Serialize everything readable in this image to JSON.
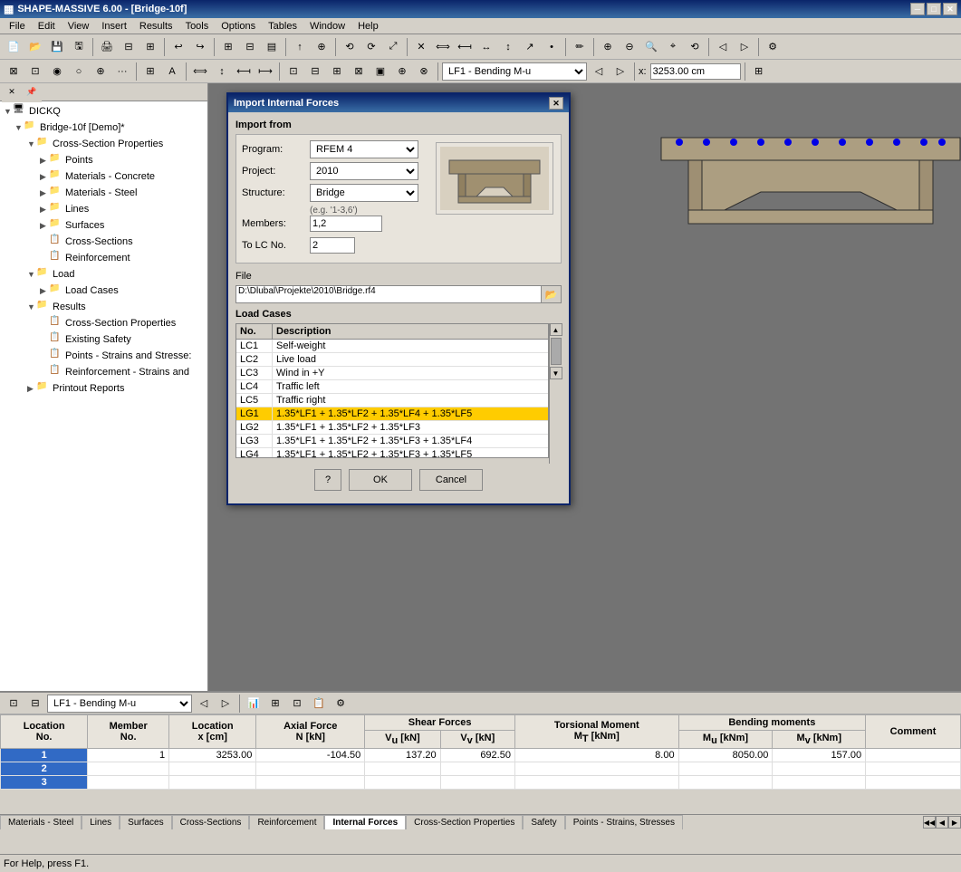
{
  "app": {
    "title": "SHAPE-MASSIVE 6.00 - [Bridge-10f]",
    "icon": "▦"
  },
  "menu": {
    "items": [
      "File",
      "Edit",
      "View",
      "Insert",
      "Results",
      "Tools",
      "Options",
      "Tables",
      "Window",
      "Help"
    ]
  },
  "titlebar": {
    "minimize": "─",
    "maximize": "□",
    "close": "✕",
    "inner_minimize": "─",
    "inner_maximize": "□",
    "inner_close": "✕"
  },
  "toolbar1": {
    "buttons": [
      "📄",
      "💾",
      "🖨",
      "✂",
      "📋",
      "↩",
      "↪",
      "📐",
      "🔍",
      "📊",
      "🔧"
    ]
  },
  "toolbar2": {
    "combo_value": "LF1 - Bending M-u",
    "coord_label": "x:",
    "coord_value": "3253.00 cm"
  },
  "left_panel": {
    "root": "DICKQ",
    "tree_items": [
      {
        "id": "root",
        "label": "DICKQ",
        "indent": 0,
        "expanded": true,
        "type": "root"
      },
      {
        "id": "bridge",
        "label": "Bridge-10f [Demo]*",
        "indent": 1,
        "expanded": true,
        "type": "project"
      },
      {
        "id": "cross-section",
        "label": "Cross-Section Properties",
        "indent": 2,
        "expanded": true,
        "type": "folder"
      },
      {
        "id": "points",
        "label": "Points",
        "indent": 3,
        "expanded": false,
        "type": "folder"
      },
      {
        "id": "materials-concrete",
        "label": "Materials - Concrete",
        "indent": 3,
        "expanded": false,
        "type": "folder"
      },
      {
        "id": "materials-steel",
        "label": "Materials - Steel",
        "indent": 3,
        "expanded": false,
        "type": "folder"
      },
      {
        "id": "lines",
        "label": "Lines",
        "indent": 3,
        "expanded": false,
        "type": "folder"
      },
      {
        "id": "surfaces",
        "label": "Surfaces",
        "indent": 3,
        "expanded": false,
        "type": "folder"
      },
      {
        "id": "cross-sections",
        "label": "Cross-Sections",
        "indent": 3,
        "expanded": false,
        "type": "item"
      },
      {
        "id": "reinforcement",
        "label": "Reinforcement",
        "indent": 3,
        "expanded": false,
        "type": "item"
      },
      {
        "id": "load",
        "label": "Load",
        "indent": 2,
        "expanded": true,
        "type": "folder"
      },
      {
        "id": "load-cases",
        "label": "Load Cases",
        "indent": 3,
        "expanded": false,
        "type": "folder"
      },
      {
        "id": "results",
        "label": "Results",
        "indent": 2,
        "expanded": true,
        "type": "folder"
      },
      {
        "id": "res-cross",
        "label": "Cross-Section Properties",
        "indent": 3,
        "expanded": false,
        "type": "item"
      },
      {
        "id": "res-existing",
        "label": "Existing Safety",
        "indent": 3,
        "expanded": false,
        "type": "item"
      },
      {
        "id": "res-points",
        "label": "Points - Strains and Stresse:",
        "indent": 3,
        "expanded": false,
        "type": "item"
      },
      {
        "id": "res-reinf",
        "label": "Reinforcement - Strains and",
        "indent": 3,
        "expanded": false,
        "type": "item"
      },
      {
        "id": "printout",
        "label": "Printout Reports",
        "indent": 2,
        "expanded": false,
        "type": "folder"
      }
    ]
  },
  "dialog": {
    "title": "Import Internal Forces",
    "import_from_label": "Import from",
    "program_label": "Program:",
    "program_value": "RFEM 4",
    "project_label": "Project:",
    "project_value": "2010",
    "structure_label": "Structure:",
    "structure_value": "Bridge",
    "members_hint": "(e.g. '1-3,6')",
    "members_label": "Members:",
    "members_value": "1,2",
    "to_lc_label": "To LC No.",
    "to_lc_value": "2",
    "file_label": "File",
    "file_path": "D:\\Dlubal\\Projekte\\2010\\Bridge.rf4",
    "load_cases_label": "Load Cases",
    "col_no": "No.",
    "col_desc": "Description",
    "load_cases": [
      {
        "no": "LC1",
        "desc": "Self-weight",
        "selected": false
      },
      {
        "no": "LC2",
        "desc": "Live load",
        "selected": false
      },
      {
        "no": "LC3",
        "desc": "Wind in +Y",
        "selected": false
      },
      {
        "no": "LC4",
        "desc": "Traffic left",
        "selected": false
      },
      {
        "no": "LC5",
        "desc": "Traffic right",
        "selected": false
      },
      {
        "no": "LG1",
        "desc": "1.35*LF1 + 1.35*LF2 + 1.35*LF4 + 1.35*LF5",
        "selected": true
      },
      {
        "no": "LG2",
        "desc": "1.35*LF1 + 1.35*LF2 + 1.35*LF3",
        "selected": false
      },
      {
        "no": "LG3",
        "desc": "1.35*LF1 + 1.35*LF2 + 1.35*LF3 + 1.35*LF4",
        "selected": false
      },
      {
        "no": "LG4",
        "desc": "1.35*LF1 + 1.35*LF2 + 1.35*LF3 + 1.35*LF5",
        "selected": false
      }
    ],
    "ok_label": "OK",
    "cancel_label": "Cancel"
  },
  "bottom_toolbar": {
    "combo_value": "LF1 - Bending M-u"
  },
  "table": {
    "headers": [
      "Location No.",
      "Member No.",
      "Location x [cm]",
      "Axial Force N [kN]",
      "Shear Forces Vu [kN]",
      "Shear Forces Vv [kN]",
      "Torsional Moment MT [kNm]",
      "Bending moments Mu [kNm]",
      "Bending moments Mv [kNm]",
      "Comment"
    ],
    "rows": [
      {
        "loc": "1",
        "member": "1",
        "x": "3253.00",
        "n": "-104.50",
        "vu": "137.20",
        "vv": "692.50",
        "mt": "8.00",
        "mu": "8050.00",
        "mv": "157.00",
        "comment": ""
      },
      {
        "loc": "2",
        "member": "",
        "x": "",
        "n": "",
        "vu": "",
        "vv": "",
        "mt": "",
        "mu": "",
        "mv": "",
        "comment": ""
      },
      {
        "loc": "3",
        "member": "",
        "x": "",
        "n": "",
        "vu": "",
        "vv": "",
        "mt": "",
        "mu": "",
        "mv": "",
        "comment": ""
      }
    ]
  },
  "tabs": [
    "Materials - Steel",
    "Lines",
    "Surfaces",
    "Cross-Sections",
    "Reinforcement",
    "Internal Forces",
    "Cross-Section Properties",
    "Safety",
    "Points - Strains, Stresses"
  ],
  "active_tab": "Internal Forces",
  "status_bar": {
    "text": "For Help, press F1."
  }
}
